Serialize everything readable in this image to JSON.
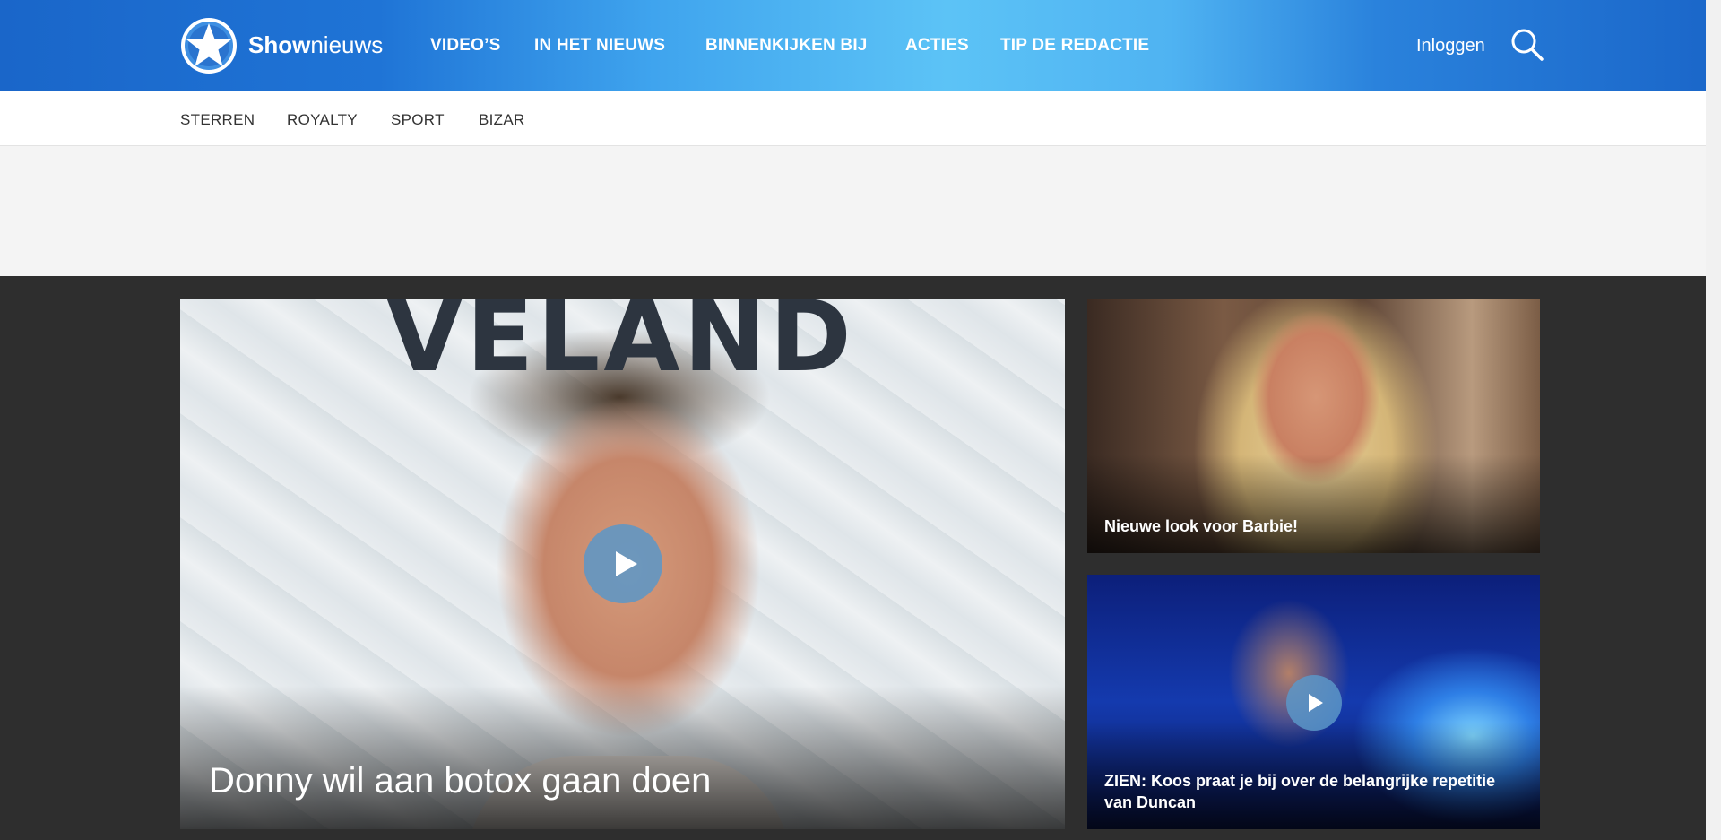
{
  "header": {
    "brand_bold": "Show",
    "brand_light": "nieuws",
    "nav": [
      "VIDEO’S",
      "IN HET NIEUWS",
      "BINNENKIJKEN BIJ",
      "ACTIES",
      "TIP DE REDACTIE"
    ],
    "login_label": "Inloggen"
  },
  "subnav": [
    "STERREN",
    "ROYALTY",
    "SPORT",
    "BIZAR"
  ],
  "articles": {
    "hero": {
      "title": "Donny wil aan botox gaan doen",
      "bg_word": "VELAND"
    },
    "side1": {
      "title": "Nieuwe look voor Barbie!"
    },
    "side2": {
      "title": "ZIEN: Koos praat je bij over de belangrijke repetitie van Duncan"
    }
  },
  "colors": {
    "header_blue": "#1a66c9",
    "header_light_blue": "#5cc3f6",
    "content_bg": "#2e2e2e",
    "ad_bg": "#f4f4f4"
  },
  "icons": {
    "logo": "star-logo-icon",
    "search": "search-icon",
    "play": "play-icon"
  }
}
